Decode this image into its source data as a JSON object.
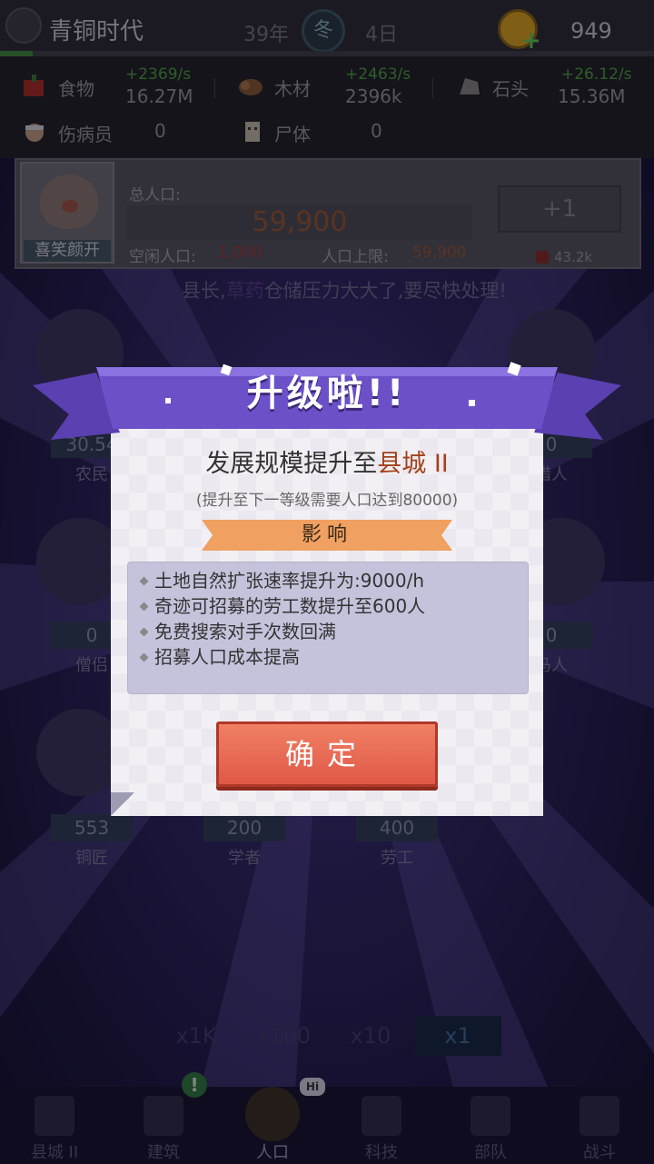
{
  "header": {
    "era": "青铜时代",
    "year": "39年",
    "season": "冬",
    "day": "4日",
    "gold": "949",
    "season_progress": 0.05
  },
  "resources": [
    {
      "name": "食物",
      "rate": "+2369/s",
      "value": "16.27M",
      "icon": "food-icon"
    },
    {
      "name": "木材",
      "rate": "+2463/s",
      "value": "2396k",
      "icon": "wood-icon"
    },
    {
      "name": "石头",
      "rate": "+26.12/s",
      "value": "15.36M",
      "icon": "stone-icon"
    },
    {
      "name": "伤病员",
      "value": "0",
      "icon": "wounded-icon"
    },
    {
      "name": "尸体",
      "value": "0",
      "icon": "corpse-icon"
    }
  ],
  "population": {
    "avatar_label": "喜笑颜开",
    "title": "总人口:",
    "total": "59,900",
    "idle_label": "空闲人口:",
    "idle_value": "1,000",
    "cap_label": "人口上限:",
    "cap_value": "59,900",
    "add_label": "+1",
    "cost": "43.2k"
  },
  "notice": {
    "prefix": "县长,",
    "highlight": "草药",
    "suffix": "仓储压力大大了,要尽快处理!"
  },
  "characters": [
    {
      "count": "30.54",
      "name": "农民"
    },
    {
      "count": "0",
      "name": "猎人"
    },
    {
      "count": "0",
      "name": "僧侣"
    },
    {
      "count": "0",
      "name": "马人"
    },
    {
      "count": "553",
      "name": "铜匠"
    },
    {
      "count": "200",
      "name": "学者"
    },
    {
      "count": "400",
      "name": "劳工"
    }
  ],
  "multipliers": [
    "x1K",
    "x100",
    "x10",
    "x1"
  ],
  "nav": [
    {
      "label": "县城 II",
      "icon": "castle-icon"
    },
    {
      "label": "建筑",
      "icon": "house-icon"
    },
    {
      "label": "人口",
      "icon": "person-icon"
    },
    {
      "label": "科技",
      "icon": "book-icon"
    },
    {
      "label": "部队",
      "icon": "banner-icon"
    },
    {
      "label": "战斗",
      "icon": "swords-icon"
    }
  ],
  "nav_badge": "!",
  "nav_hi": "Hi",
  "modal": {
    "ribbon_title": "升级啦!!",
    "title_prefix": "发展规模提升至",
    "title_city": "县城 II",
    "subtitle": "(提升至下一等级需要人口达到80000)",
    "banner": "影响",
    "effects": [
      "土地自然扩张速率提升为:9000/h",
      "奇迹可招募的劳工数提升至600人",
      "免费搜索对手次数回满",
      "招募人口成本提高"
    ],
    "confirm": "确定"
  },
  "colors": {
    "accent_orange": "#f0a060",
    "ribbon_purple": "#6b50c8",
    "confirm_red": "#e05848",
    "rate_green": "#4da63a"
  }
}
